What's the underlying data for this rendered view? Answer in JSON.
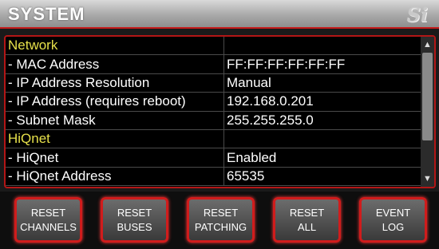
{
  "header": {
    "title": "SYSTEM",
    "logo": "Si"
  },
  "rows": [
    {
      "label": "Network",
      "value": "",
      "type": "section"
    },
    {
      "label": "- MAC Address",
      "value": "FF:FF:FF:FF:FF:FF",
      "type": "item"
    },
    {
      "label": "- IP Address Resolution",
      "value": "Manual",
      "type": "item"
    },
    {
      "label": "- IP Address (requires reboot)",
      "value": "192.168.0.201",
      "type": "item"
    },
    {
      "label": "- Subnet Mask",
      "value": "255.255.255.0",
      "type": "item"
    },
    {
      "label": "HiQnet",
      "value": "",
      "type": "section"
    },
    {
      "label": "- HiQnet",
      "value": "Enabled",
      "type": "item"
    },
    {
      "label": "- HiQnet Address",
      "value": "65535",
      "type": "item"
    }
  ],
  "buttons": [
    {
      "label": "RESET\nCHANNELS"
    },
    {
      "label": "RESET\nBUSES"
    },
    {
      "label": "RESET\nPATCHING"
    },
    {
      "label": "RESET\nALL"
    },
    {
      "label": "EVENT\nLOG"
    }
  ],
  "icons": {
    "scroll_up": "up-arrow-icon",
    "scroll_down": "down-arrow-icon"
  },
  "colors": {
    "accent": "#d01c1c",
    "section_text": "#e6e04a"
  }
}
